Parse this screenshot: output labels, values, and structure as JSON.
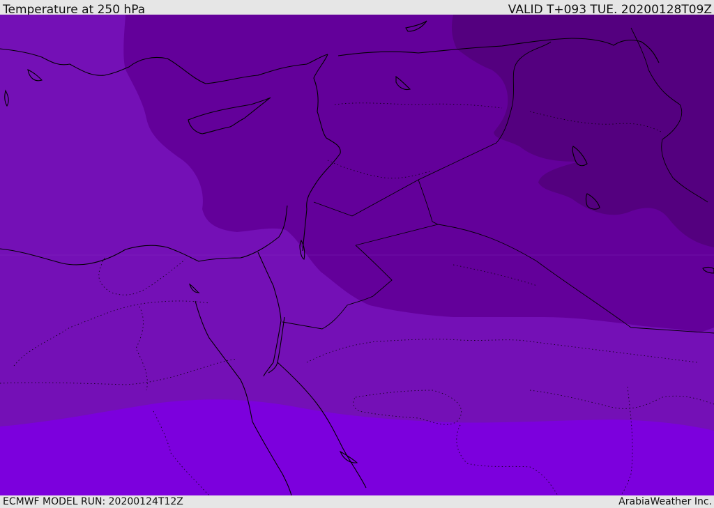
{
  "header": {
    "title": "Temperature at 250 hPa",
    "valid_time": "VALID T+093 TUE. 20200128T09Z"
  },
  "footer": {
    "model_run": "ECMWF MODEL RUN: 20200124T12Z",
    "credit": "ArabiaWeather Inc."
  },
  "colors": {
    "band_coldest": "#54007f",
    "band_cold": "#63009a",
    "band_mid": "#7410b6",
    "band_warm": "#7c00dd",
    "coastline": "#000000",
    "border": "#000000",
    "bars": "#e6e6e6"
  }
}
